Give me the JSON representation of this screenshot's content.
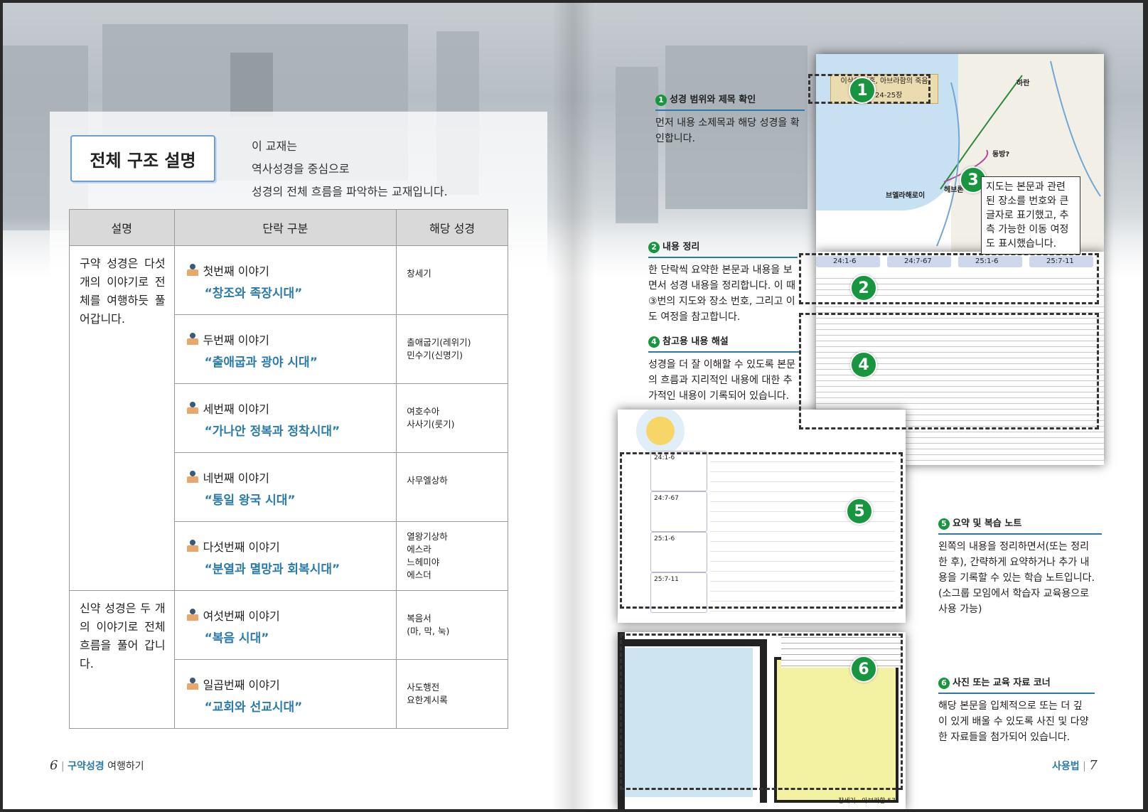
{
  "left_page": {
    "title": "전체 구조 설명",
    "intro": [
      "이 교재는",
      "역사성경을 중심으로",
      "성경의 전체 흐름을 파악하는 교재입니다."
    ],
    "table": {
      "headers": [
        "설명",
        "단락 구분",
        "해당 성경"
      ],
      "groups": [
        {
          "description": "구약 성경은 다섯 개의 이야기로 전체를 여행하듯 풀어갑니다."
        },
        {
          "description": "신약 성경은 두 개의 이야기로 전체 흐름을 풀어 갑니다."
        }
      ],
      "rows": [
        {
          "order": "첫번째 이야기",
          "name": "“창조와 족장시대”",
          "books": [
            "창세기"
          ]
        },
        {
          "order": "두번째 이야기",
          "name": "“출애굽과 광야 시대”",
          "books": [
            "출애굽기(레위기)",
            "민수기(신명기)"
          ]
        },
        {
          "order": "세번째 이야기",
          "name": "“가나안 정복과 정착시대”",
          "books": [
            "여호수아",
            "사사기(룻기)"
          ]
        },
        {
          "order": "네번째 이야기",
          "name": "“통일 왕국 시대”",
          "books": [
            "사무엘상하"
          ]
        },
        {
          "order": "다섯번째 이야기",
          "name": "“분열과 멸망과 회복시대”",
          "books": [
            "열왕기상하",
            "에스라",
            "느헤미야",
            "에스더"
          ]
        },
        {
          "order": "여섯번째 이야기",
          "name": "“복음 시대”",
          "books": [
            "복음서",
            "(마, 막, 눅)"
          ]
        },
        {
          "order": "일곱번째 이야기",
          "name": "“교회와 선교시대”",
          "books": [
            "사도행전",
            "요한계시록"
          ]
        }
      ]
    },
    "footer": {
      "page": "6",
      "section": "구약성경",
      "suffix": "여행하기"
    }
  },
  "right_page": {
    "notes": [
      {
        "num": "1",
        "title": "성경 범위와 제목 확인",
        "lines": [
          "먼저 내용 소제목과 해당 성경을 확",
          "인합니다."
        ]
      },
      {
        "num": "2",
        "title": "내용 정리",
        "lines": [
          "한 단락씩 요약한 본문과 내용을 보",
          "면서 성경 내용을 정리합니다. 이 때",
          "③번의 지도와 장소 번호, 그리고 이",
          "도 여정을 참고합니다."
        ]
      },
      {
        "num": "4",
        "title": "참고용 내용 해설",
        "lines": [
          "성경을 더 잘 이해할 수 있도록 본문",
          "의 흐름과 지리적인 내용에 대한 추",
          "가적인 내용이 기록되어 있습니다."
        ]
      },
      {
        "num": "5",
        "title": "요약 및 복습 노트",
        "lines": [
          "왼쪽의 내용을 정리하면서(또는 정리",
          "한 후), 간략하게 요약하거나 추가 내",
          "용을 기록할 수 있는 학습 노트입니다.",
          "(소그룹 모임에서 학습자 교육용으로",
          "사용 가능)"
        ]
      },
      {
        "num": "6",
        "title": "사진 또는 교육 자료 코너",
        "lines": [
          "해당 본문을 입체적으로 또는 더 깊",
          "이 있게 배울 수 있도록 사진 및 다양",
          "한 자료들을 첨가되어 있습니다."
        ]
      }
    ],
    "callout_3": [
      "지도는 본문과 관련",
      "된 장소를 번호와 큰",
      "글자로 표기했고, 추",
      "측 가능한 이동 여정",
      "도 표시했습니다."
    ],
    "badges": [
      "1",
      "2",
      "3",
      "4",
      "5",
      "6"
    ],
    "map": {
      "title": "이삭의 결혼, 아브라함의 죽음",
      "ref": "창 24-25장",
      "places": [
        "하란",
        "동방?",
        "헤브론",
        "브엘라해로이"
      ]
    },
    "text_tabs": [
      "24:1-6",
      "24:7-67",
      "25:1-6",
      "25:7-11"
    ],
    "note_refs": [
      "24:1-6",
      "24:7-67",
      "25:1-6",
      "25:7-11"
    ],
    "plan_caption": "창세기 · 아브라함",
    "plan_page": "57",
    "footer": {
      "label": "사용법",
      "page": "7"
    }
  }
}
